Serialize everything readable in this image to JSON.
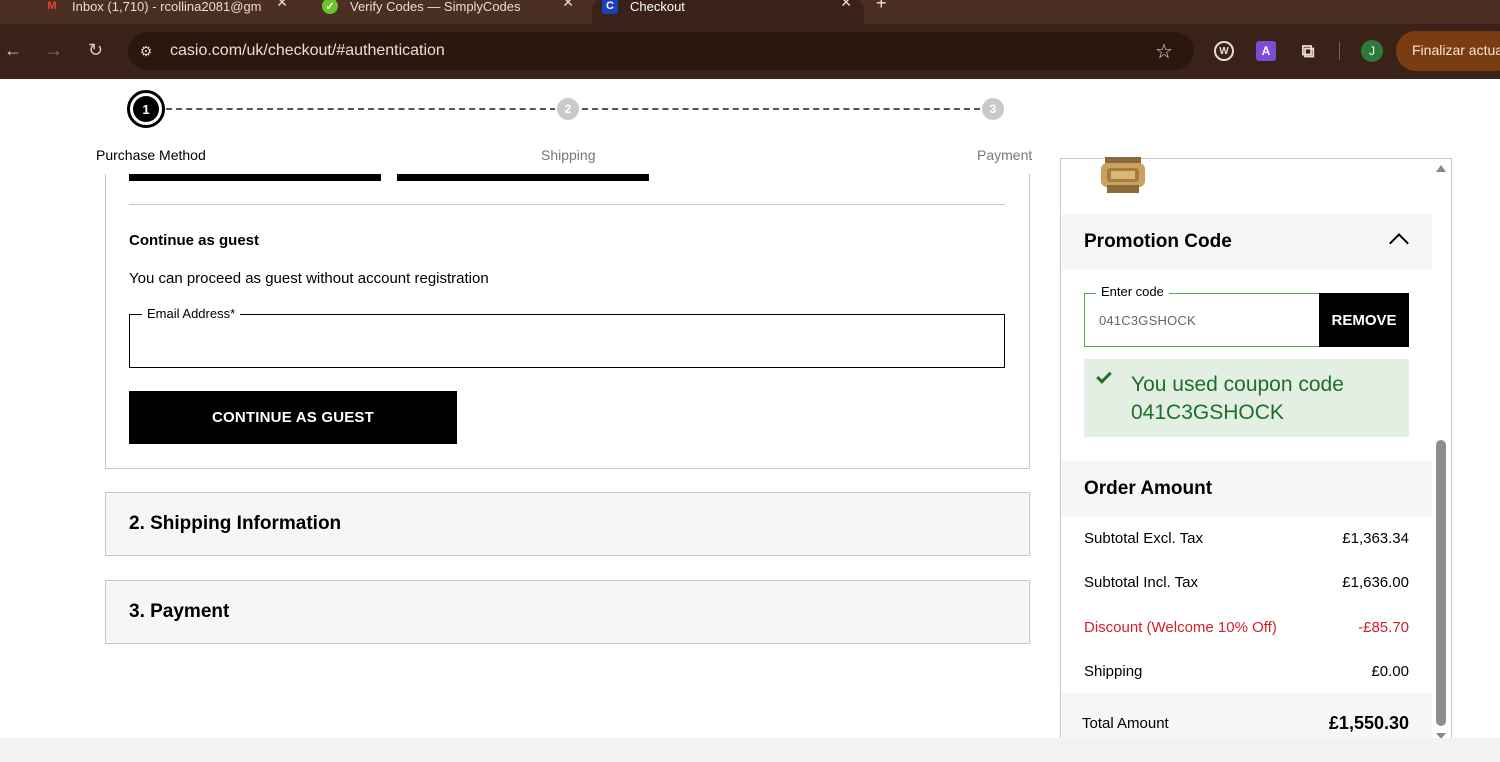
{
  "browser": {
    "tabs": [
      {
        "title": "Inbox (1,710) - rcollina2081@gm",
        "icon": "gmail-icon"
      },
      {
        "title": "Verify Codes — SimplyCodes",
        "icon": "simplycodes-icon"
      },
      {
        "title": "Checkout",
        "icon": "casio-icon"
      }
    ],
    "new_tab": "+",
    "url": "casio.com/uk/checkout/#authentication",
    "ext_w": "W",
    "ext_a": "A",
    "avatar_letter": "J",
    "update_label": "Finalizar actua"
  },
  "stepper": {
    "steps": [
      {
        "number": "1",
        "label": "Purchase Method"
      },
      {
        "number": "2",
        "label": "Shipping"
      },
      {
        "number": "3",
        "label": "Payment"
      }
    ]
  },
  "guest": {
    "heading": "Continue as guest",
    "description": "You can proceed as guest without account registration",
    "email_label": "Email Address*",
    "email_value": "",
    "button_label": "CONTINUE AS GUEST"
  },
  "sections": {
    "shipping": "2. Shipping Information",
    "payment": "3. Payment"
  },
  "promo": {
    "title": "Promotion Code",
    "input_label": "Enter code",
    "input_value": "041C3GSHOCK",
    "remove_label": "REMOVE",
    "success_message": "You used coupon code 041C3GSHOCK"
  },
  "order": {
    "title": "Order Amount",
    "rows": [
      {
        "label": "Subtotal Excl. Tax",
        "value": "£1,363.34"
      },
      {
        "label": "Subtotal Incl. Tax",
        "value": "£1,636.00"
      },
      {
        "label": "Discount (Welcome 10% Off)",
        "value": "-£85.70"
      },
      {
        "label": "Shipping",
        "value": "£0.00"
      }
    ],
    "total_label": "Total Amount",
    "total_value": "£1,550.30"
  },
  "colors": {
    "discount": "#d32027",
    "success_text": "#1f6e2a",
    "success_bg": "#e2efe2",
    "chrome": "#3b2218"
  }
}
